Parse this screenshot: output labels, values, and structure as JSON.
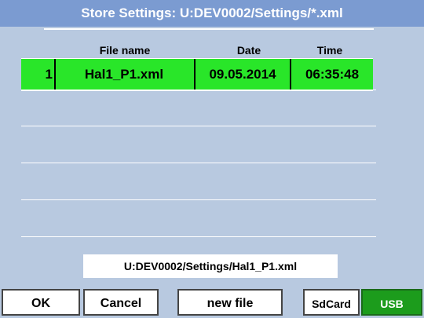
{
  "title": "Store Settings:  U:DEV0002/Settings/*.xml",
  "table": {
    "headers": {
      "file_name": "File name",
      "date": "Date",
      "time": "Time"
    },
    "rows": [
      {
        "index": "1",
        "file_name": "Hal1_P1.xml",
        "date": "09.05.2014",
        "time": "06:35:48",
        "selected": true
      }
    ]
  },
  "path": "U:DEV0002/Settings/Hal1_P1.xml",
  "buttons": {
    "ok": "OK",
    "cancel": "Cancel",
    "new_file": "new file",
    "sdcard": "SdCard",
    "usb": "USB"
  },
  "colors": {
    "title_bar": "#7b9bd1",
    "background": "#b8c9e0",
    "selected_row": "#29e629",
    "usb_active": "#1c9c1c"
  }
}
